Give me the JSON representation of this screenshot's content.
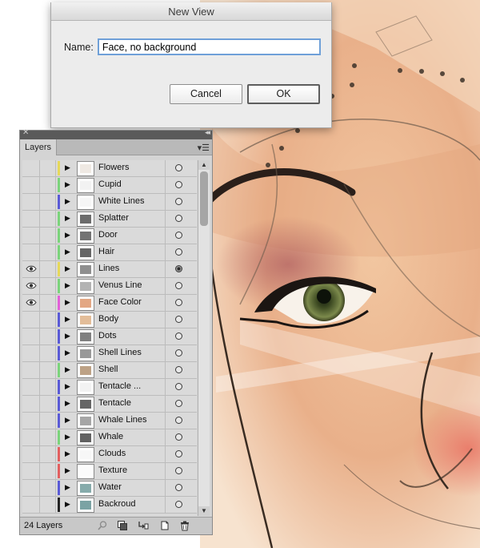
{
  "dialog": {
    "title": "New View",
    "name_label": "Name:",
    "name_value": "Face, no background",
    "cancel_label": "Cancel",
    "ok_label": "OK"
  },
  "layers_panel": {
    "tab_label": "Layers",
    "layer_count": "24 Layers",
    "layers": [
      {
        "name": "Flowers",
        "color": "#e6d85a",
        "visible": false,
        "targeted": false,
        "thumb": "#e9e2d9"
      },
      {
        "name": "Cupid",
        "color": "#7bd47b",
        "visible": false,
        "targeted": false,
        "thumb": "#eeeeee"
      },
      {
        "name": "White Lines",
        "color": "#5a5ad6",
        "visible": false,
        "targeted": false,
        "thumb": "#f3f3f3"
      },
      {
        "name": "Splatter",
        "color": "#7bd47b",
        "visible": false,
        "targeted": false,
        "thumb": "#3b3b3b"
      },
      {
        "name": "Door",
        "color": "#7bd47b",
        "visible": false,
        "targeted": false,
        "thumb": "#444444"
      },
      {
        "name": "Hair",
        "color": "#7bd47b",
        "visible": false,
        "targeted": false,
        "thumb": "#333333"
      },
      {
        "name": "Lines",
        "color": "#e6d85a",
        "visible": true,
        "targeted": true,
        "thumb": "#6a6a6a"
      },
      {
        "name": "Venus Line",
        "color": "#7bd47b",
        "visible": true,
        "targeted": false,
        "thumb": "#9a9a9a"
      },
      {
        "name": "Face Color",
        "color": "#e25fd8",
        "visible": true,
        "targeted": false,
        "thumb": "#d98a5a"
      },
      {
        "name": "Body",
        "color": "#5a5ad6",
        "visible": false,
        "targeted": false,
        "thumb": "#d9a777"
      },
      {
        "name": "Dots",
        "color": "#5a5ad6",
        "visible": false,
        "targeted": false,
        "thumb": "#555555"
      },
      {
        "name": "Shell Lines",
        "color": "#5a5ad6",
        "visible": false,
        "targeted": false,
        "thumb": "#777777"
      },
      {
        "name": "Shell",
        "color": "#7bd47b",
        "visible": false,
        "targeted": false,
        "thumb": "#a7835e"
      },
      {
        "name": "Tentacle ...",
        "color": "#5a5ad6",
        "visible": false,
        "targeted": false,
        "thumb": "#eeeeee"
      },
      {
        "name": "Tentacle",
        "color": "#5a5ad6",
        "visible": false,
        "targeted": false,
        "thumb": "#333333"
      },
      {
        "name": "Whale Lines",
        "color": "#5a5ad6",
        "visible": false,
        "targeted": false,
        "thumb": "#888888"
      },
      {
        "name": "Whale",
        "color": "#7bd47b",
        "visible": false,
        "targeted": false,
        "thumb": "#2e2e2e"
      },
      {
        "name": "Clouds",
        "color": "#e25f5f",
        "visible": false,
        "targeted": false,
        "thumb": "#f4f4f4"
      },
      {
        "name": "Texture",
        "color": "#e25f5f",
        "visible": false,
        "targeted": false,
        "thumb": "#fafafa"
      },
      {
        "name": "Water",
        "color": "#5a5ad6",
        "visible": false,
        "targeted": false,
        "thumb": "#5e8f8f"
      },
      {
        "name": "Backroud",
        "color": "#222222",
        "visible": false,
        "targeted": false,
        "thumb": "#4f8486"
      }
    ]
  },
  "icons": {
    "eye": "eye-icon",
    "disclosure": "disclosure-triangle-icon",
    "target": "target-circle-icon",
    "panel_menu": "panel-menu-icon",
    "locate": "locate-object-icon",
    "clipping_mask": "clipping-mask-icon",
    "new_sublayer": "new-sublayer-icon",
    "new_layer": "new-layer-icon",
    "delete": "trash-icon"
  }
}
